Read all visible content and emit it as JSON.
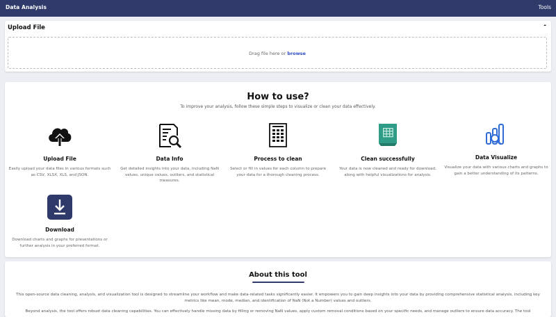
{
  "navbar": {
    "title": "Data Analysis",
    "tools_label": "Tools"
  },
  "upload": {
    "header": "Upload File",
    "toggle": "-",
    "drag_text": "Drag file here or ",
    "browse_label": "browse"
  },
  "howto": {
    "title": "How to use?",
    "subtitle": "To improve your analysis, follow these simple steps to visualize or clean your data effectively.",
    "steps": [
      {
        "title": "Upload File",
        "desc": "Easily upload your data files in various formats such as CSV, XLSX, XLS, and JSON.",
        "icon": "cloud-upload-icon"
      },
      {
        "title": "Data Info",
        "desc": "Get detailed insights into your data, including NaN values, unique values, outliers, and statistical measures.",
        "icon": "document-search-icon"
      },
      {
        "title": "Process to clean",
        "desc": "Select or fill in values for each column to prepare your data for a thorough cleaning process.",
        "icon": "spreadsheet-icon"
      },
      {
        "title": "Clean successfully",
        "desc": "Your data is now cleaned and ready for download, along with helpful visualizations for analysis.",
        "icon": "clean-sheet-icon"
      },
      {
        "title": "Data Visualize",
        "desc": "Visualize your data with various charts and graphs to gain a better understanding of its patterns.",
        "icon": "chart-search-icon"
      },
      {
        "title": "Download",
        "desc": "Download charts and graphs for presentations or further analysis in your preferred format.",
        "icon": "download-icon"
      }
    ]
  },
  "about": {
    "title": "About this tool",
    "p1": "This open-source data cleaning, analysis, and visualization tool is designed to streamline your workflow and make data-related tasks significantly easier. It empowers you to gain deep insights into your data by providing comprehensive statistical analysis, including key metrics like mean, mode, median, and identification of NaN (Not a Number) values and outliers.",
    "p2": "Beyond analysis, the tool offers robust data cleaning capabilities. You can effectively handle missing data by filling or removing NaN values, apply custom removal conditions based on your specific needs, and manage outliers to ensure data accuracy. The tool"
  },
  "colors": {
    "navbar": "#2f3a6b",
    "accent": "#2e4bc7",
    "teal": "#2e9c86"
  }
}
